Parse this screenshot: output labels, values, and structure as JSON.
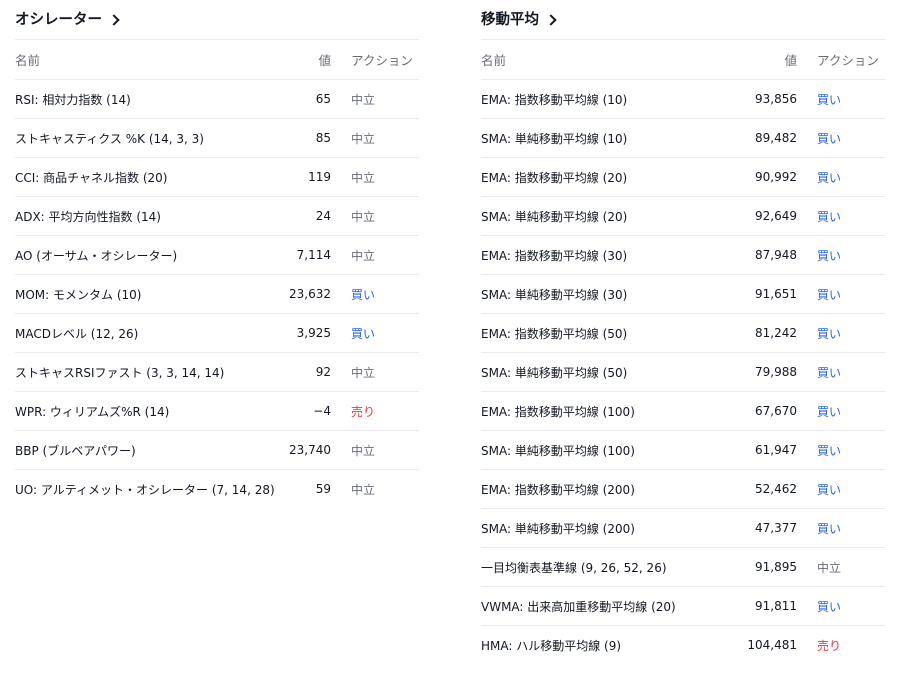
{
  "oscillators": {
    "title": "オシレーター",
    "headers": {
      "name": "名前",
      "value": "値",
      "action": "アクション"
    },
    "rows": [
      {
        "name": "RSI: 相対力指数 (14)",
        "value": "65",
        "action": "中立",
        "type": "neutral"
      },
      {
        "name": "ストキャスティクス %K (14, 3, 3)",
        "value": "85",
        "action": "中立",
        "type": "neutral"
      },
      {
        "name": "CCI: 商品チャネル指数 (20)",
        "value": "119",
        "action": "中立",
        "type": "neutral"
      },
      {
        "name": "ADX: 平均方向性指数 (14)",
        "value": "24",
        "action": "中立",
        "type": "neutral"
      },
      {
        "name": "AO (オーサム・オシレーター)",
        "value": "7,114",
        "action": "中立",
        "type": "neutral"
      },
      {
        "name": "MOM: モメンタム (10)",
        "value": "23,632",
        "action": "買い",
        "type": "buy"
      },
      {
        "name": "MACDレベル (12, 26)",
        "value": "3,925",
        "action": "買い",
        "type": "buy"
      },
      {
        "name": "ストキャスRSIファスト (3, 3, 14, 14)",
        "value": "92",
        "action": "中立",
        "type": "neutral"
      },
      {
        "name": "WPR: ウィリアムズ%R (14)",
        "value": "−4",
        "action": "売り",
        "type": "sell"
      },
      {
        "name": "BBP (ブルベアパワー)",
        "value": "23,740",
        "action": "中立",
        "type": "neutral"
      },
      {
        "name": "UO: アルティメット・オシレーター (7, 14, 28)",
        "value": "59",
        "action": "中立",
        "type": "neutral"
      }
    ]
  },
  "moving_averages": {
    "title": "移動平均",
    "headers": {
      "name": "名前",
      "value": "値",
      "action": "アクション"
    },
    "rows": [
      {
        "name": "EMA: 指数移動平均線 (10)",
        "value": "93,856",
        "action": "買い",
        "type": "buy"
      },
      {
        "name": "SMA: 単純移動平均線 (10)",
        "value": "89,482",
        "action": "買い",
        "type": "buy"
      },
      {
        "name": "EMA: 指数移動平均線 (20)",
        "value": "90,992",
        "action": "買い",
        "type": "buy"
      },
      {
        "name": "SMA: 単純移動平均線 (20)",
        "value": "92,649",
        "action": "買い",
        "type": "buy"
      },
      {
        "name": "EMA: 指数移動平均線 (30)",
        "value": "87,948",
        "action": "買い",
        "type": "buy"
      },
      {
        "name": "SMA: 単純移動平均線 (30)",
        "value": "91,651",
        "action": "買い",
        "type": "buy"
      },
      {
        "name": "EMA: 指数移動平均線 (50)",
        "value": "81,242",
        "action": "買い",
        "type": "buy"
      },
      {
        "name": "SMA: 単純移動平均線 (50)",
        "value": "79,988",
        "action": "買い",
        "type": "buy"
      },
      {
        "name": "EMA: 指数移動平均線 (100)",
        "value": "67,670",
        "action": "買い",
        "type": "buy"
      },
      {
        "name": "SMA: 単純移動平均線 (100)",
        "value": "61,947",
        "action": "買い",
        "type": "buy"
      },
      {
        "name": "EMA: 指数移動平均線 (200)",
        "value": "52,462",
        "action": "買い",
        "type": "buy"
      },
      {
        "name": "SMA: 単純移動平均線 (200)",
        "value": "47,377",
        "action": "買い",
        "type": "buy"
      },
      {
        "name": "一目均衡表基準線 (9, 26, 52, 26)",
        "value": "91,895",
        "action": "中立",
        "type": "neutral"
      },
      {
        "name": "VWMA: 出来高加重移動平均線 (20)",
        "value": "91,811",
        "action": "買い",
        "type": "buy"
      },
      {
        "name": "HMA: ハル移動平均線 (9)",
        "value": "104,481",
        "action": "売り",
        "type": "sell"
      }
    ]
  },
  "colors": {
    "buy": "#2962ff",
    "sell": "#f23645",
    "neutral": "#6a6d78",
    "text": "#131722",
    "divider": "#e8eaee"
  },
  "icons": {
    "title_link": "chevron-right-icon"
  }
}
